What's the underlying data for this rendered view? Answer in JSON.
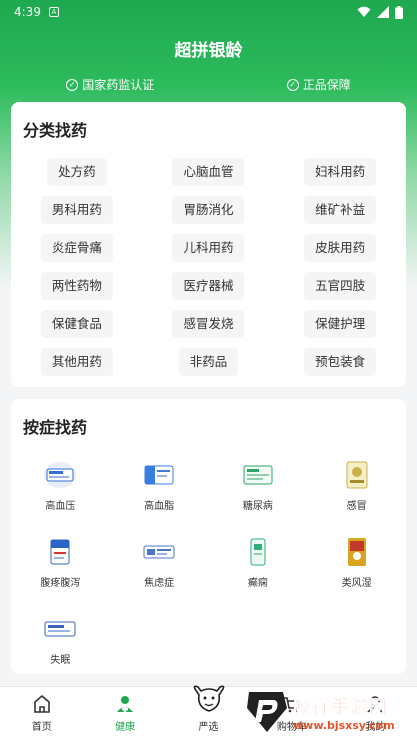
{
  "status": {
    "time": "4:39",
    "notif_icon": "A"
  },
  "header": {
    "title": "超拼银龄"
  },
  "badges": [
    {
      "label": "国家药监认证"
    },
    {
      "label": "正品保障"
    }
  ],
  "categories": {
    "title": "分类找药",
    "items": [
      "处方药",
      "心脑血管",
      "妇科用药",
      "男科用药",
      "胃肠消化",
      "维矿补益",
      "炎症骨痛",
      "儿科用药",
      "皮肤用药",
      "两性药物",
      "医疗器械",
      "五官四肢",
      "保健食品",
      "感冒发烧",
      "保健护理",
      "其他用药",
      "非药品",
      "预包装食"
    ]
  },
  "symptoms": {
    "title": "按症找药",
    "items": [
      {
        "label": "高血压",
        "color": "#2f6fd6"
      },
      {
        "label": "高血脂",
        "color": "#3a7de0"
      },
      {
        "label": "糖尿病",
        "color": "#2ea36a"
      },
      {
        "label": "感冒",
        "color": "#c8b04a"
      },
      {
        "label": "腹疼腹泻",
        "color": "#2a66c8"
      },
      {
        "label": "焦虑症",
        "color": "#4b74c9"
      },
      {
        "label": "癫痫",
        "color": "#2fae7a"
      },
      {
        "label": "类风湿",
        "color": "#d8a520"
      },
      {
        "label": "失眠",
        "color": "#3b62b8"
      }
    ]
  },
  "tabbar": {
    "items": [
      {
        "label": "首页"
      },
      {
        "label": "健康"
      },
      {
        "label": "严选"
      },
      {
        "label": "购物车"
      },
      {
        "label": "我的"
      }
    ],
    "active_color": "#1ea84f"
  },
  "watermark": {
    "name": "顺祥手游网",
    "url": "www.bjsxsy.com"
  }
}
